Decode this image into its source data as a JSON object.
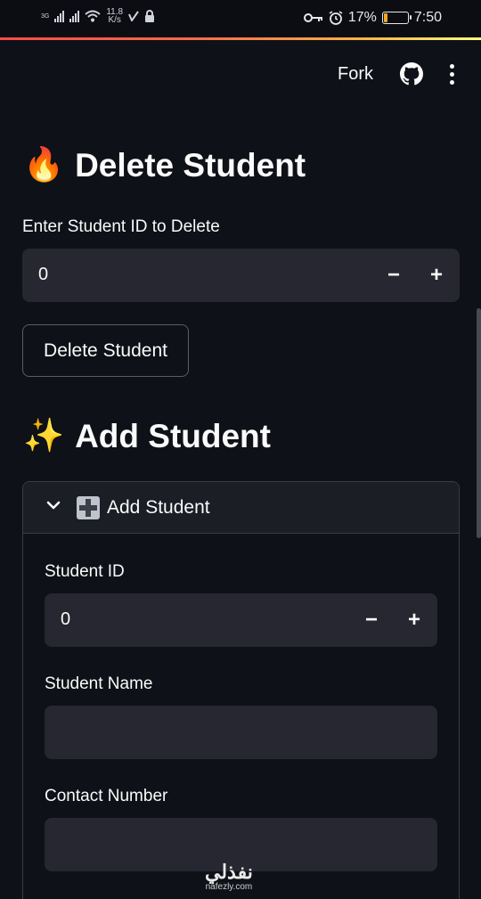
{
  "status_bar": {
    "network": "3G",
    "speed_value": "11.8",
    "speed_unit": "K/s",
    "battery_percent": "17%",
    "battery_level": 0.17,
    "time": "7:50",
    "icons": [
      "signal-icon",
      "wifi-icon",
      "check-icon",
      "lock-icon",
      "key-icon",
      "alarm-icon",
      "battery-icon"
    ]
  },
  "header": {
    "fork_label": "Fork",
    "github_icon": "github-icon",
    "menu_icon": "more-vertical-icon"
  },
  "delete_section": {
    "emoji": "🔥",
    "title": "Delete Student",
    "input_label": "Enter Student ID to Delete",
    "input_value": "0",
    "minus": "−",
    "plus": "+",
    "button_label": "Delete Student"
  },
  "add_section": {
    "emoji": "✨",
    "title": "Add Student",
    "expander_title": "Add Student",
    "student_id_label": "Student ID",
    "student_id_value": "0",
    "minus": "−",
    "plus": "+",
    "student_name_label": "Student Name",
    "student_name_value": "",
    "contact_label": "Contact Number",
    "contact_value": ""
  },
  "watermark": {
    "arabic": "نفذلي",
    "latin": "nafezly.com"
  },
  "colors": {
    "background": "#0e1117",
    "input_bg": "#262730",
    "accent_gradient_start": "#ff4b4b",
    "accent_gradient_end": "#fffd80",
    "battery": "#f5a623"
  }
}
